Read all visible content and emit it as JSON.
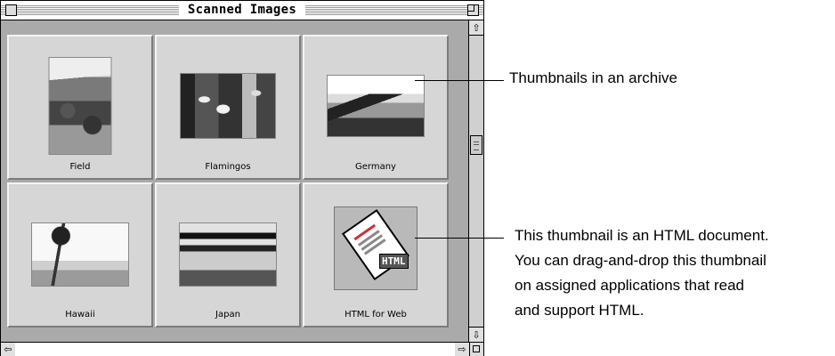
{
  "window": {
    "title": "Scanned Images"
  },
  "items": [
    {
      "label": "Field"
    },
    {
      "label": "Flamingos"
    },
    {
      "label": "Germany"
    },
    {
      "label": "Hawaii"
    },
    {
      "label": "Japan"
    },
    {
      "label": "HTML for Web",
      "badge": "HTML"
    }
  ],
  "scrollbars": {
    "vertical": {
      "up_icon": "⇧",
      "down_icon": "⇩"
    },
    "horizontal": {
      "left_icon": "⇦",
      "right_icon": "⇨"
    }
  },
  "callouts": {
    "archive": "Thumbnails in an archive",
    "html_lines": [
      "This thumbnail is an HTML document.",
      "You can drag-and-drop this thumbnail",
      "on assigned applications that read",
      "and support HTML."
    ]
  }
}
